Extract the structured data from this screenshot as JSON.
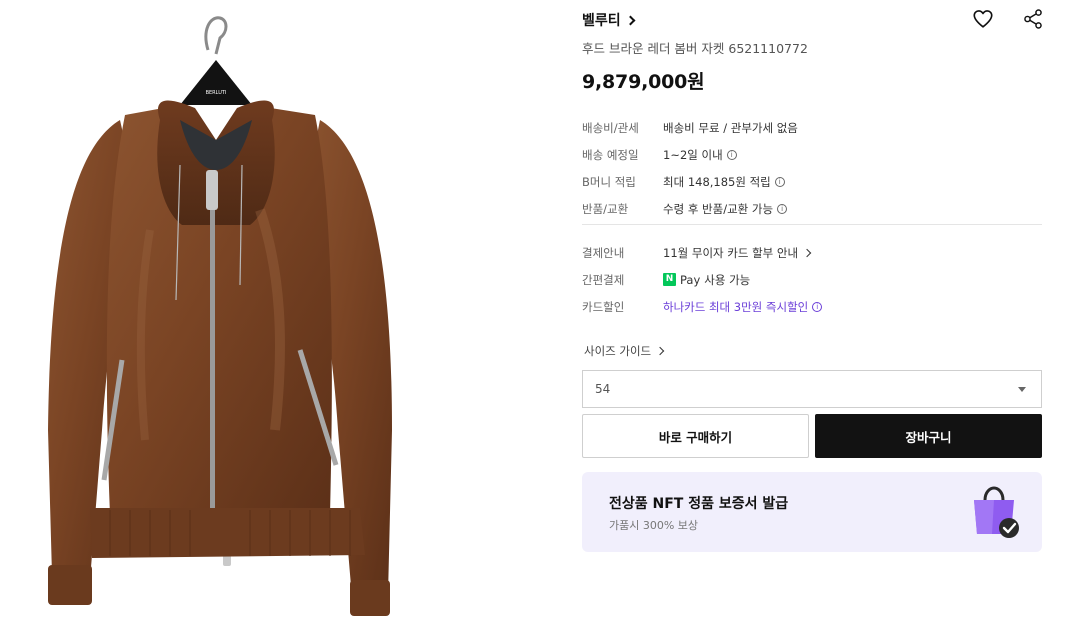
{
  "product": {
    "brand": "벨루티",
    "name": "후드 브라운 레더 봄버 자켓 6521110772",
    "price": "9,879,000원",
    "image_tag": "BERLUTI"
  },
  "info_primary": [
    {
      "label": "배송비/관세",
      "value": "배송비 무료 / 관부가세 없음"
    },
    {
      "label": "배송 예정일",
      "value": "1~2일 이내"
    },
    {
      "label": "B머니 적립",
      "value": "최대 148,185원 적립"
    },
    {
      "label": "반품/교환",
      "value": "수령 후 반품/교환 가능"
    }
  ],
  "info_payment": [
    {
      "label": "결제안내",
      "value": "11월 무이자 카드 할부 안내"
    },
    {
      "label": "간편결제",
      "logo": "N",
      "brand": "Pay",
      "value": "사용 가능"
    },
    {
      "label": "카드할인",
      "value": "하나카드 최대 3만원 즉시할인"
    }
  ],
  "size": {
    "guide_label": "사이즈 가이드",
    "selected": "54"
  },
  "buttons": {
    "buy": "바로 구매하기",
    "cart": "장바구니"
  },
  "nft_banner": {
    "title": "전상품 NFT 정품 보증서 발급",
    "subtitle": "가품시 300% 보상"
  },
  "icons": {
    "wishlist": "heart-icon",
    "share": "share-icon",
    "info": "info-icon",
    "nft": "shopping-bag-check-icon"
  },
  "colors": {
    "accent_purple": "#6b3fd8",
    "npay_green": "#03c75a",
    "cart_button": "#121212",
    "nft_banner_bg": "#f1effc",
    "jacket_brown": "#7a4424"
  }
}
